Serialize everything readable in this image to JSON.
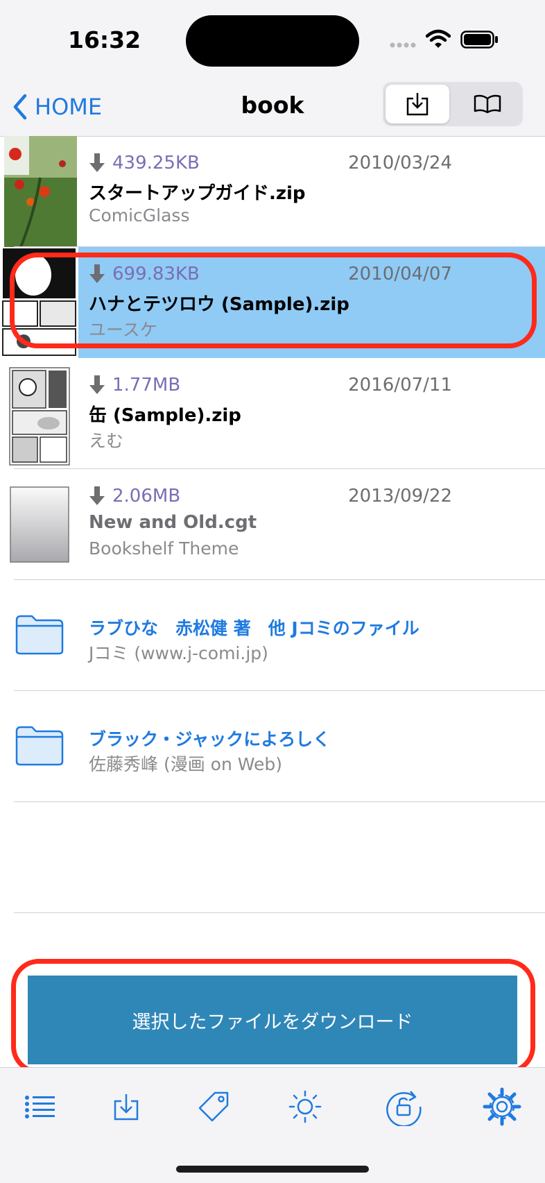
{
  "status": {
    "time": "16:32"
  },
  "nav": {
    "back_label": "HOME",
    "title": "book"
  },
  "files": [
    {
      "size": "439.25KB",
      "date": "2010/03/24",
      "name": "スタートアップガイド.zip",
      "author": "ComicGlass"
    },
    {
      "size": "699.83KB",
      "date": "2010/04/07",
      "name": "ハナとテツロウ (Sample).zip",
      "author": "ユースケ",
      "selected": true
    },
    {
      "size": "1.77MB",
      "date": "2016/07/11",
      "name": "缶 (Sample).zip",
      "author": "えむ"
    },
    {
      "size": "2.06MB",
      "date": "2013/09/22",
      "name": "New and Old.cgt",
      "author": "Bookshelf Theme"
    }
  ],
  "folders": [
    {
      "title": "ラブひな　赤松健 著　他 Jコミのファイル",
      "subtitle": "Jコミ (www.j-comi.jp)"
    },
    {
      "title": "ブラック・ジャックによろしく",
      "subtitle": "佐藤秀峰 (漫画 on Web)"
    }
  ],
  "download_button": "選択したファイルをダウンロード",
  "colors": {
    "accent": "#1f7ae0",
    "selected_row": "#8fcbf5",
    "download_button": "#2f87b8",
    "highlight": "#ff2a1a"
  },
  "tabs": [
    "list-icon",
    "download-tray-icon",
    "tag-icon",
    "brightness-icon",
    "rotation-lock-icon",
    "gear-icon"
  ]
}
